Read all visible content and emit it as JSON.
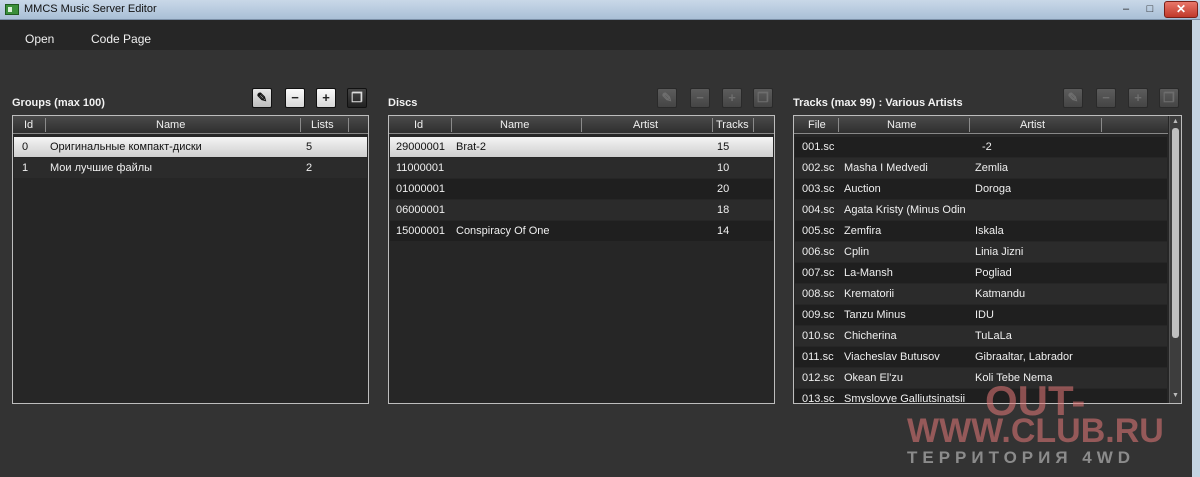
{
  "window": {
    "title": "MMCS Music Server Editor",
    "minimize": "–",
    "maximize": "□",
    "close": "✕"
  },
  "menu": {
    "items": [
      "Open",
      "Code Page"
    ]
  },
  "groups": {
    "title": "Groups (max 100)",
    "columns": [
      "Id",
      "Name",
      "Lists"
    ],
    "rows": [
      {
        "id": "0",
        "name": "Оригинальные компакт-диски",
        "lists": "5",
        "selected": true
      },
      {
        "id": "1",
        "name": "Мои лучшие файлы",
        "lists": "2"
      }
    ]
  },
  "discs": {
    "title": "Discs",
    "columns": [
      "Id",
      "Name",
      "Artist",
      "Tracks"
    ],
    "rows": [
      {
        "id": "29000001",
        "name": "Brat-2",
        "artist": "",
        "tracks": "15",
        "selected": true
      },
      {
        "id": "11000001",
        "name": "",
        "artist": "",
        "tracks": "10"
      },
      {
        "id": "01000001",
        "name": "",
        "artist": "",
        "tracks": "20"
      },
      {
        "id": "06000001",
        "name": "",
        "artist": "",
        "tracks": "18"
      },
      {
        "id": "15000001",
        "name": "Conspiracy Of One",
        "artist": "",
        "tracks": "14"
      }
    ]
  },
  "tracks": {
    "title": "Tracks (max 99) : Various Artists",
    "columns": [
      "File",
      "Name",
      "Artist"
    ],
    "rows": [
      {
        "file": "001.sc",
        "name": "",
        "artist": "-2"
      },
      {
        "file": "002.sc",
        "name": "Masha I Medvedi",
        "artist": "Zemlia"
      },
      {
        "file": "003.sc",
        "name": "Auction",
        "artist": "Doroga"
      },
      {
        "file": "004.sc",
        "name": "Agata Kristy (Minus Odin",
        "artist": ""
      },
      {
        "file": "005.sc",
        "name": "Zemfira",
        "artist": "Iskala"
      },
      {
        "file": "006.sc",
        "name": "Cplin",
        "artist": "Linia Jizni"
      },
      {
        "file": "007.sc",
        "name": "La-Mansh",
        "artist": "Pogliad"
      },
      {
        "file": "008.sc",
        "name": "Krematorii",
        "artist": "Katmandu"
      },
      {
        "file": "009.sc",
        "name": "Tanzu Minus",
        "artist": "IDU"
      },
      {
        "file": "010.sc",
        "name": "Chicherina",
        "artist": "TuLaLa"
      },
      {
        "file": "011.sc",
        "name": "Viacheslav Butusov",
        "artist": "Gibraaltar, Labrador"
      },
      {
        "file": "012.sc",
        "name": "Okean El'zu",
        "artist": "Koli Tebe Nema"
      },
      {
        "file": "013.sc",
        "name": "Smyslovye Galliutsinatsii",
        "artist": ""
      }
    ]
  },
  "toolbar": {
    "edit": "✎",
    "remove": "−",
    "add": "+",
    "copy": "❐"
  },
  "watermark": {
    "line1": "OUT-",
    "line2": "WWW.CLUB.RU",
    "line3": "ТЕРРИТОРИЯ 4WD"
  },
  "colors": {
    "background": "#333333",
    "grid": "#262626",
    "selected": "#e6e6e6",
    "titlebar": "#b7cadf",
    "close": "#c0392b"
  }
}
